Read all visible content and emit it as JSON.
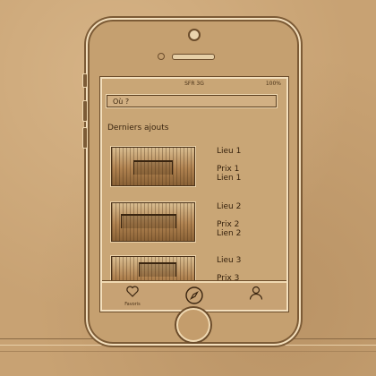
{
  "status_bar": {
    "carrier": "SFR 3G",
    "battery": "100%"
  },
  "search": {
    "placeholder": "Où ?"
  },
  "section": {
    "title": "Derniers ajouts"
  },
  "items": [
    {
      "name": "Lieu 1",
      "price": "Prix 1",
      "link": "Lien 1"
    },
    {
      "name": "Lieu 2",
      "price": "Prix 2",
      "link": "Lien 2"
    },
    {
      "name": "Lieu 3",
      "price": "Prix 3",
      "link": ""
    }
  ],
  "tabbar": {
    "tabs": [
      {
        "icon": "heart-icon",
        "label": "Favoris"
      },
      {
        "icon": "compass-icon",
        "label": ""
      },
      {
        "icon": "user-icon",
        "label": ""
      }
    ]
  },
  "colors": {
    "background": "#c8a273",
    "ink": "#3a2510",
    "highlight": "#f3dfbd"
  }
}
